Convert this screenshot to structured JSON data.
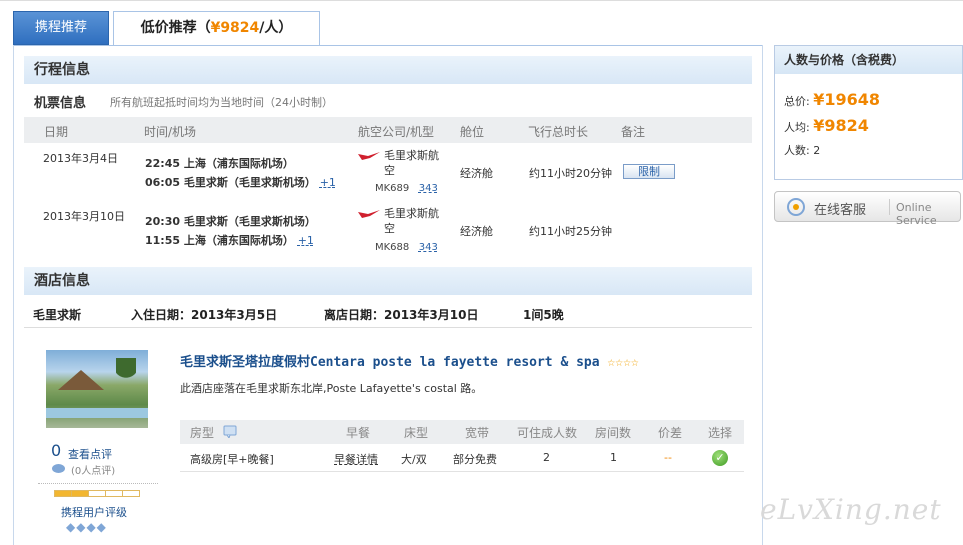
{
  "tabs": {
    "tab1": "携程推荐",
    "tab2_prefix": "低价推荐（",
    "tab2_price": "¥9824",
    "tab2_suffix": "/人）"
  },
  "itinerary": {
    "section_title": "行程信息",
    "flight_title": "机票信息",
    "flight_note": "所有航班起抵时间均为当地时间（24小时制）",
    "columns": [
      "日期",
      "时间/机场",
      "航空公司/机型",
      "舱位",
      "飞行总时长",
      "备注"
    ],
    "flights": [
      {
        "date": "2013年3月4日",
        "dep": "22:45 上海（浦东国际机场）",
        "arr": "06:05 毛里求斯（毛里求斯机场）",
        "plus": "+1",
        "airline_line1": "毛里求斯航",
        "airline_line2": "空",
        "code": "MK689",
        "craft": "343",
        "cabin": "经济舱",
        "duration": "约11小时20分钟",
        "note": "限制"
      },
      {
        "date": "2013年3月10日",
        "dep": "20:30 毛里求斯（毛里求斯机场）",
        "arr": "11:55 上海（浦东国际机场）",
        "plus": "+1",
        "airline_line1": "毛里求斯航",
        "airline_line2": "空",
        "code": "MK688",
        "craft": "343",
        "cabin": "经济舱",
        "duration": "约11小时25分钟"
      }
    ]
  },
  "hotel": {
    "section_title": "酒店信息",
    "destination": "毛里求斯",
    "checkin": "入住日期：2013年3月5日",
    "checkout": "离店日期：2013年3月10日",
    "rooms_nights": "1间5晚",
    "name": "毛里求斯圣塔拉度假村Centara poste la fayette resort & spa",
    "stars": "☆☆☆☆",
    "description": "此酒店座落在毛里求斯东北岸,Poste Lafayette's costal 路。",
    "review_score": "0",
    "review_link": "查看点评",
    "review_count": "(0人点评)",
    "rating_label": "携程用户评级",
    "rating_diamonds": "◆◆◆◆",
    "rating_filled_fraction": 0.4,
    "room_columns": [
      "房型",
      "早餐",
      "床型",
      "宽带",
      "可住成人数",
      "房间数",
      "价差",
      "选择"
    ],
    "room": {
      "type": "高级房[早+晚餐]",
      "breakfast": "早餐详情",
      "bed": "大/双",
      "broadband": "部分免费",
      "adults": "2",
      "rooms": "1",
      "price_diff": "--"
    }
  },
  "price_box": {
    "title": "人数与价格（含税费）",
    "total_label": "总价:",
    "total_value": "¥19648",
    "per_label": "人均:",
    "per_value": "¥9824",
    "people_label": "人数: 2"
  },
  "service": {
    "label": "在线客服",
    "label_en": "Online Service"
  },
  "watermark": "eLvXing.net",
  "colors": {
    "accent_orange": "#f08600",
    "link_blue": "#1b4f8c",
    "header_blue": "#2f6fbf"
  }
}
